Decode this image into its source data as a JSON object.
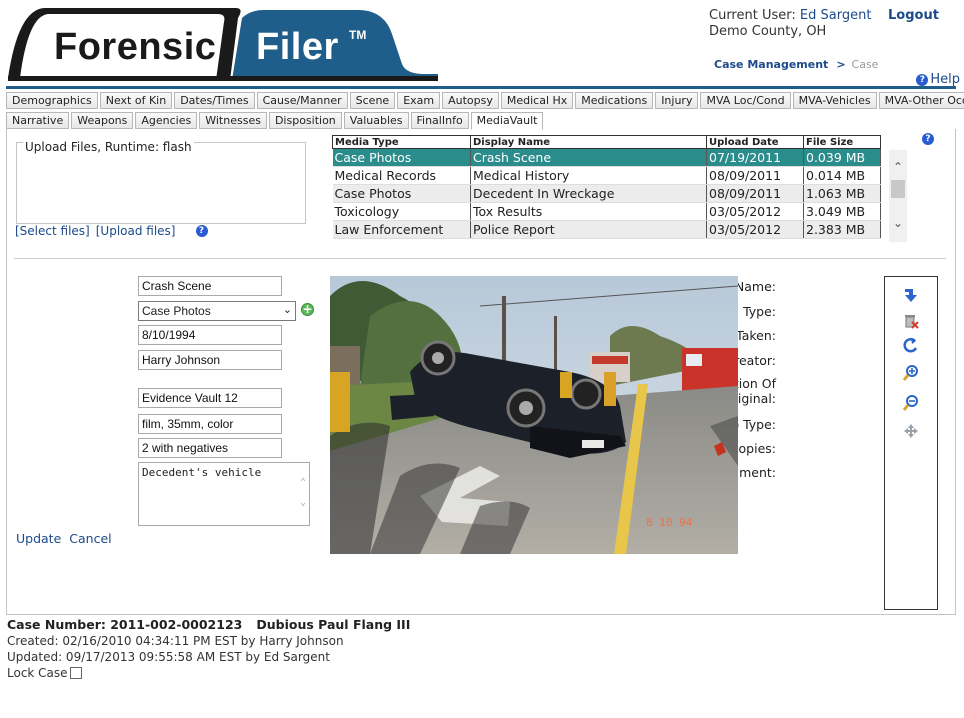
{
  "logo": {
    "word1": "Forensic",
    "word2": "Filer",
    "tm": "TM"
  },
  "user": {
    "label": "Current User:",
    "name": "Ed Sargent",
    "logout": "Logout",
    "county": "Demo County, OH"
  },
  "breadcrumb": {
    "item1": "Case Management",
    "sep": ">",
    "item2": "Case"
  },
  "help": {
    "label": "Help",
    "icon": "help-icon"
  },
  "tabs_row1": [
    "Demographics",
    "Next of Kin",
    "Dates/Times",
    "Cause/Manner",
    "Scene",
    "Exam",
    "Autopsy",
    "Medical Hx",
    "Medications",
    "Injury",
    "MVA Loc/Cond",
    "MVA-Vehicles",
    "MVA-Other Occs"
  ],
  "tabs_row2": [
    "Narrative",
    "Weapons",
    "Agencies",
    "Witnesses",
    "Disposition",
    "Valuables",
    "FinalInfo",
    "MediaVault"
  ],
  "active_tab": "MediaVault",
  "upload": {
    "label": "Upload Files, Runtime: flash",
    "select": "[Select files]",
    "upload": "[Upload files]"
  },
  "media_table": {
    "headers": [
      "Media Type",
      "Display Name",
      "Upload Date",
      "File Size"
    ],
    "rows": [
      [
        "Case Photos",
        "Crash Scene",
        "07/19/2011",
        "0.039 MB"
      ],
      [
        "Medical Records",
        "Medical History",
        "08/09/2011",
        "0.014 MB"
      ],
      [
        "Case Photos",
        "Decedent In Wreckage",
        "08/09/2011",
        "1.063 MB"
      ],
      [
        "Toxicology",
        "Tox Results",
        "03/05/2012",
        "3.049 MB"
      ],
      [
        "Law Enforcement",
        "Police Report",
        "03/05/2012",
        "2.383 MB"
      ]
    ],
    "selected_row": 0
  },
  "form": {
    "friendly_name": {
      "label": "Friendly Name:",
      "value": "Crash Scene"
    },
    "media_type": {
      "label": "Media Type:",
      "value": "Case Photos"
    },
    "date_taken": {
      "label": "Date Taken:",
      "value": "8/10/1994"
    },
    "author": {
      "label": "Author/Creator:",
      "value": "Harry Johnson"
    },
    "location": {
      "label1": "Location Of",
      "label2": "Original:",
      "value": "Evidence Vault 12"
    },
    "photo_type": {
      "label": "Photo Type:",
      "value": "film, 35mm, color"
    },
    "copies": {
      "label": "Copies:",
      "value": "2 with negatives"
    },
    "comment": {
      "label": "Comment:",
      "value": "Decedent's vehicle"
    },
    "update": "Update",
    "cancel": "Cancel"
  },
  "photo": {
    "date_stamp": "8 10 94"
  },
  "toolbar_icons": [
    "download-arrow-icon",
    "delete-icon",
    "rotate-icon",
    "zoom-in-icon",
    "zoom-out-icon",
    "move-icon"
  ],
  "footer": {
    "case_number": "Case Number: 2011-002-0002123",
    "decedent": "Dubious Paul Flang III",
    "created": "Created: 02/16/2010 04:34:11 PM EST by Harry Johnson",
    "updated": "Updated: 09/17/2013 09:55:58 AM EST by Ed Sargent",
    "lock": "Lock Case"
  },
  "colors": {
    "brand_dark": "#1f5d8a",
    "selected_row": "#2b8c8c",
    "link": "#1c4a8a"
  }
}
